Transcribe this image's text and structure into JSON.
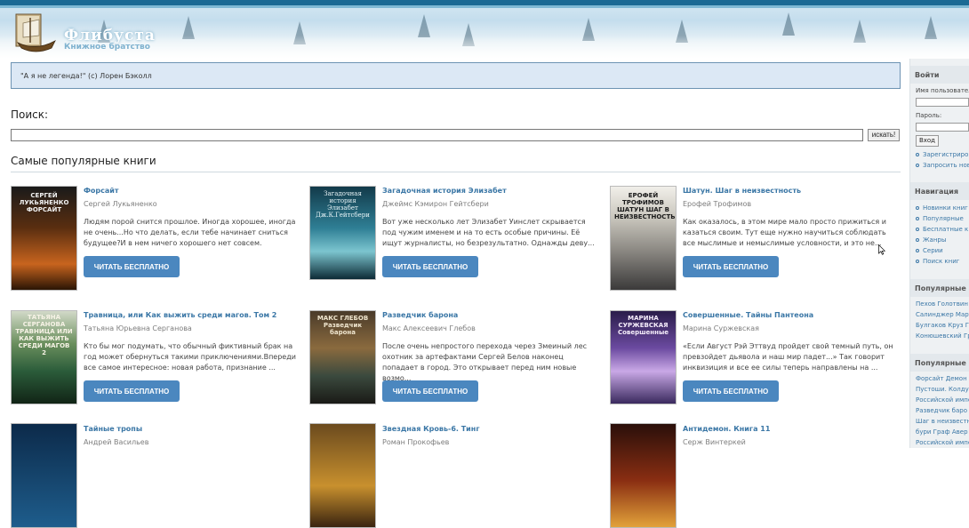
{
  "header": {
    "site_title": "Флибуста",
    "site_subtitle": "Книжное братство"
  },
  "quote": "\"А я не легенда!\" (с) Лорен Бэколл",
  "search": {
    "label": "Поиск:",
    "value": "",
    "button_label": "искать!"
  },
  "popular": {
    "title": "Самые популярные книги",
    "read_label": "ЧИТАТЬ БЕСПЛАТНО",
    "books": [
      {
        "title": "Форсайт",
        "author": "Сергей Лукьяненко",
        "description": "Людям порой снится прошлое. Иногда хорошее, иногда не очень...Но что делать, если тебе начинает сниться будущее?И в нем ничего хорошего нет совсем.",
        "cover_text": "СЕРГЕЙ ЛУКЬЯНЕНКО ФОРСАЙТ"
      },
      {
        "title": "Загадочная история Элизабет",
        "author": "Джеймс Кэмирон Гейтсбери",
        "description": "Вот уже несколько лет Элизабет Уинслет скрывается под чужим именем и на то есть особые причины. Её ищут журналисты, но безрезультатно. Однажды деву...",
        "cover_text": "Загадочная история Элизабет Дж.К.Гейтсбери"
      },
      {
        "title": "Шатун. Шаг в неизвестность",
        "author": "Ерофей Трофимов",
        "description": "Как оказалось, в этом мире мало просто прижиться и казаться своим. Тут еще нужно научиться соблюдать все мыслимые и немыслимые условности, и это не...",
        "cover_text": "ЕРОФЕЙ ТРОФИМОВ ШАТУН ШАГ В НЕИЗВЕСТНОСТЬ"
      },
      {
        "title": "Травница, или Как выжить среди магов. Том 2",
        "author": "Татьяна Юрьевна Серганова",
        "description": "Кто бы мог подумать, что обычный фиктивный брак на год может обернуться такими приключениями.Впереди все самое интересное: новая работа, признание ...",
        "cover_text": "ТАТЬЯНА СЕРГАНОВА ТРАВНИЦА ИЛИ КАК ВЫЖИТЬ СРЕДИ МАГОВ 2"
      },
      {
        "title": "Разведчик барона",
        "author": "Макс Алексеевич Глебов",
        "description": "После очень непростого перехода через Змеиный лес охотник за артефактами Сергей Белов наконец попадает в город. Это открывает перед ним новые возмо...",
        "cover_text": "МАКС ГЛЕБОВ Разведчик барона"
      },
      {
        "title": "Совершенные. Тайны Пантеона",
        "author": "Марина Суржевская",
        "description": "«Если Август Рэй Эттвуд пройдет свой темный путь, он превзойдет дьявола и наш мир падет...» Так говорит инквизиция и все ее силы теперь направлены на ...",
        "cover_text": "МАРИНА СУРЖЕВСКАЯ Совершенные"
      },
      {
        "title": "Тайные тропы",
        "author": "Андрей Васильев",
        "description": "",
        "cover_text": ""
      },
      {
        "title": "Звездная Кровь-6. Тинг",
        "author": "Роман Прокофьев",
        "description": "",
        "cover_text": ""
      },
      {
        "title": "Антидемон. Книга 11",
        "author": "Серж Винтеркей",
        "description": "",
        "cover_text": ""
      }
    ]
  },
  "sidebar": {
    "login_title": "Войти",
    "username_label": "Имя пользователя",
    "password_label": "Пароль:",
    "login_button": "Вход",
    "register_link": "Зарегистрировать",
    "new_password_link": "Запросить новый",
    "nav_title": "Навигация",
    "nav_items": [
      "Новинки книг",
      "Популярные",
      "Бесплатные к",
      "Жанры",
      "Серии",
      "Поиск книг"
    ],
    "popular_authors_title": "Популярные а",
    "popular_authors": [
      "Пехов Голотвин",
      "Салинджер Март",
      "Булгаков Круз Г",
      "Конюшевский Гр"
    ],
    "popular_books_title": "Популярные к",
    "popular_books": [
      "Форсайт Демон",
      "Пустоши. Колду",
      "Российской импе",
      "Разведчик баро",
      "Шаг в неизвестн",
      "бури Граф Авер",
      "Российской импе"
    ]
  },
  "colors": {
    "accent": "#4b87bf",
    "link": "#3b77a6",
    "quote_bg": "#dce8f5",
    "header_bar": "#1b6a94"
  }
}
